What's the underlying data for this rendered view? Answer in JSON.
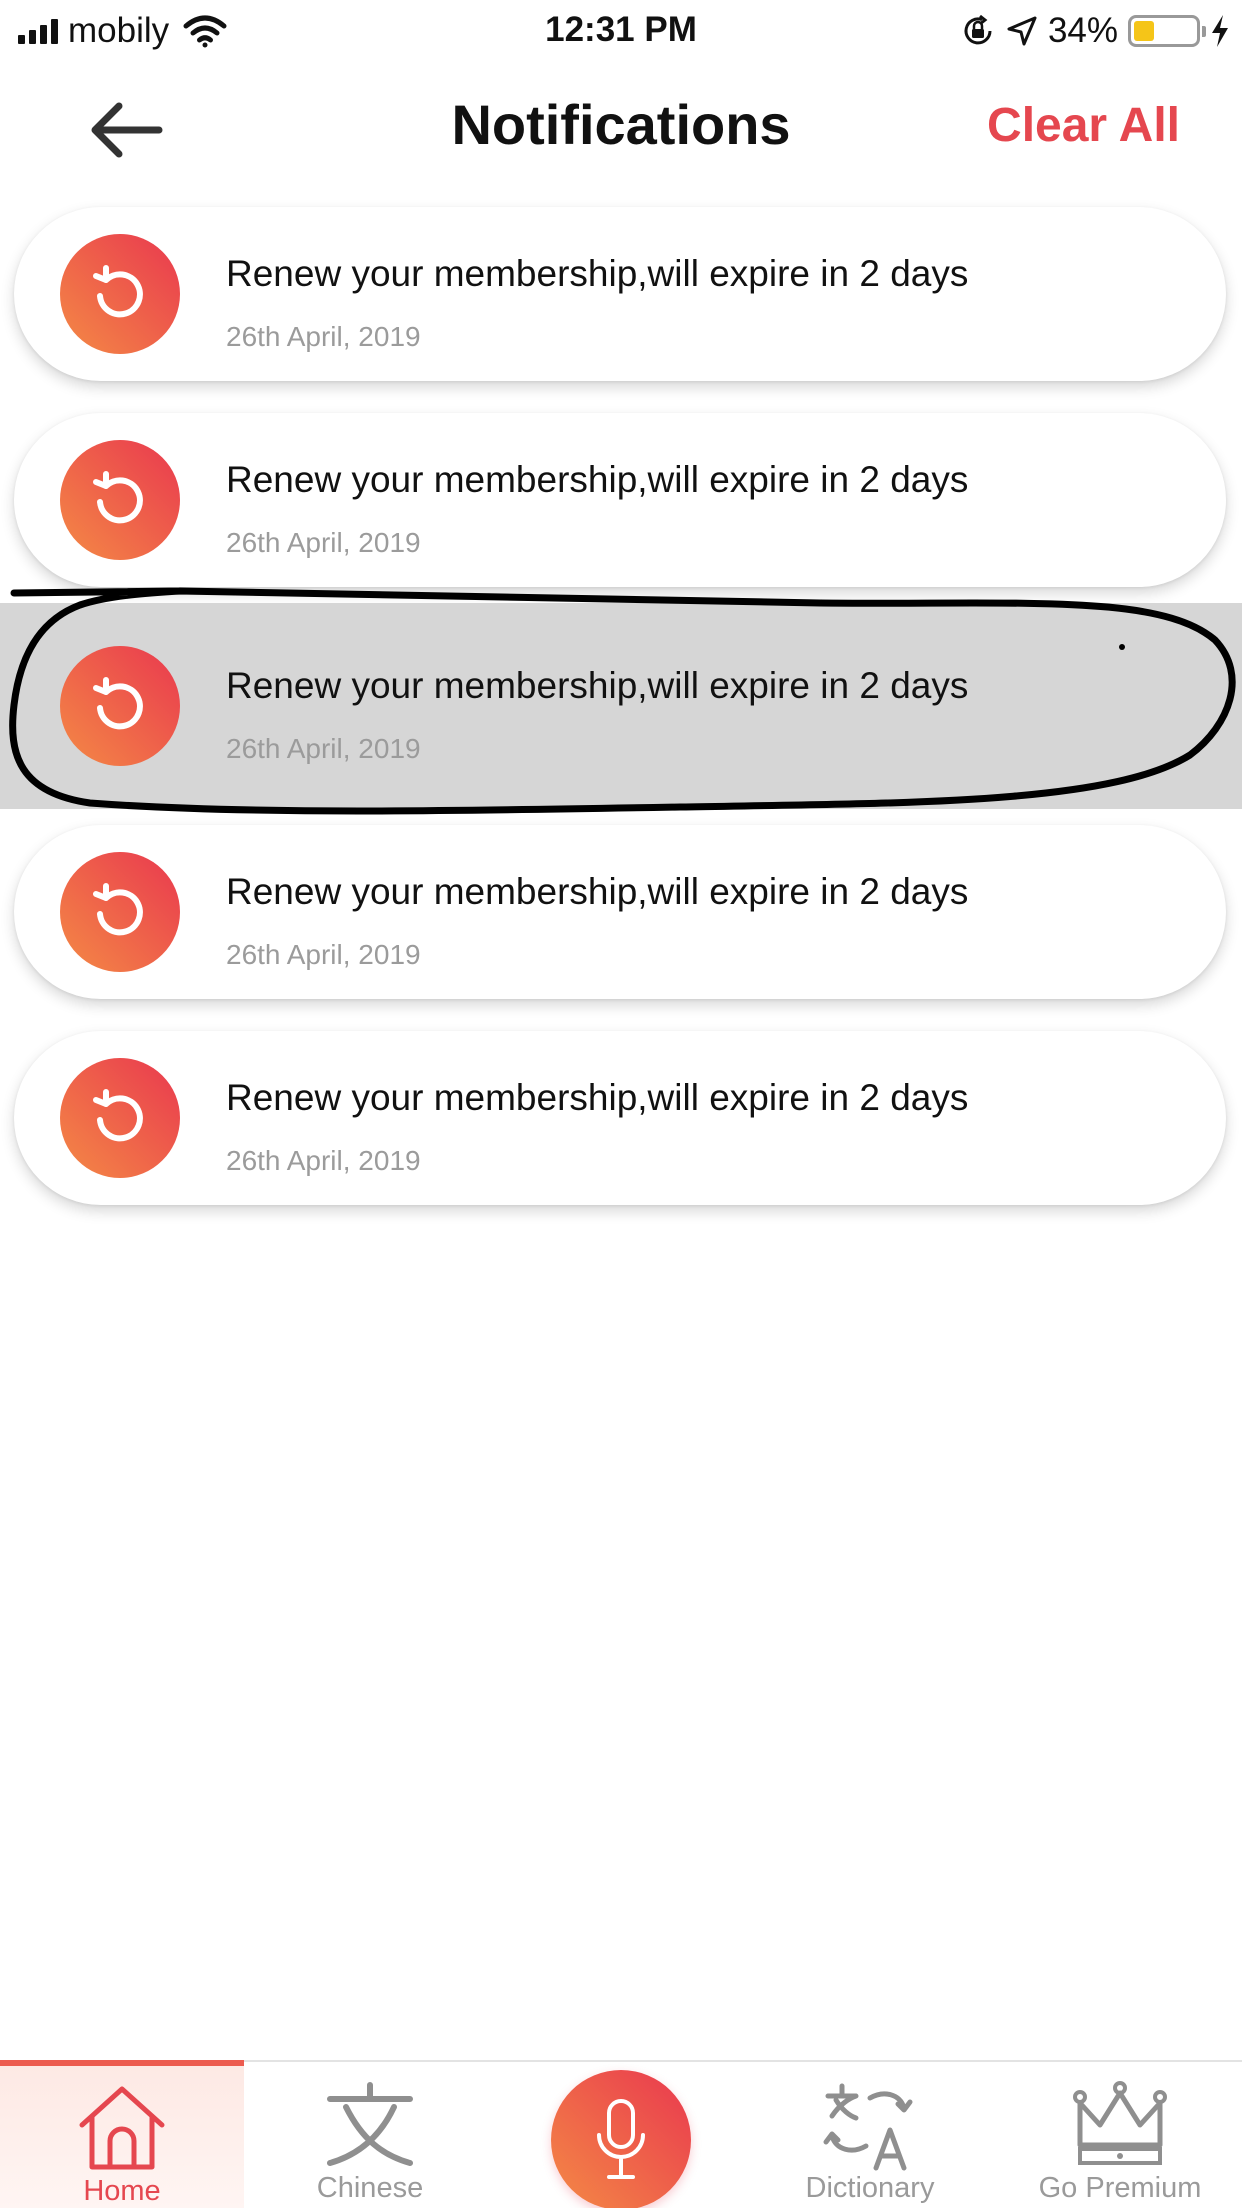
{
  "status_bar": {
    "carrier": "mobily",
    "time": "12:31 PM",
    "battery_percent": "34%",
    "battery_level": 0.34,
    "icons": [
      "signal-icon",
      "wifi-icon",
      "orientation-lock-icon",
      "location-icon",
      "battery-icon",
      "charging-icon"
    ]
  },
  "header": {
    "title": "Notifications",
    "clear_all_label": "Clear All",
    "back_icon": "arrow-left-icon"
  },
  "notifications": [
    {
      "message": "Renew your membership,will expire in 2 days",
      "date": "26th April, 2019",
      "icon": "renew-icon",
      "highlighted": false
    },
    {
      "message": "Renew your membership,will expire in 2 days",
      "date": "26th April, 2019",
      "icon": "renew-icon",
      "highlighted": false
    },
    {
      "message": "Renew your membership,will expire in 2 days",
      "date": "26th April, 2019",
      "icon": "renew-icon",
      "highlighted": true
    },
    {
      "message": "Renew your membership,will expire in 2 days",
      "date": "26th April, 2019",
      "icon": "renew-icon",
      "highlighted": false
    },
    {
      "message": "Renew your membership,will expire in 2 days",
      "date": "26th April, 2019",
      "icon": "renew-icon",
      "highlighted": false
    }
  ],
  "bottom_nav": {
    "items": [
      {
        "label": "Home",
        "icon": "home-icon",
        "active": true
      },
      {
        "label": "Chinese",
        "icon": "chinese-character-icon",
        "active": false
      },
      {
        "label": "",
        "icon": "microphone-icon",
        "active": false
      },
      {
        "label": "Dictionary",
        "icon": "translate-icon",
        "active": false
      },
      {
        "label": "Go Premium",
        "icon": "crown-icon",
        "active": false
      }
    ]
  },
  "colors": {
    "accent": "#e5474f",
    "gradient_start": "#f48a45",
    "gradient_end": "#e9384f",
    "highlight_bg": "#d6d6d6",
    "muted_text": "#9b9b9b"
  }
}
